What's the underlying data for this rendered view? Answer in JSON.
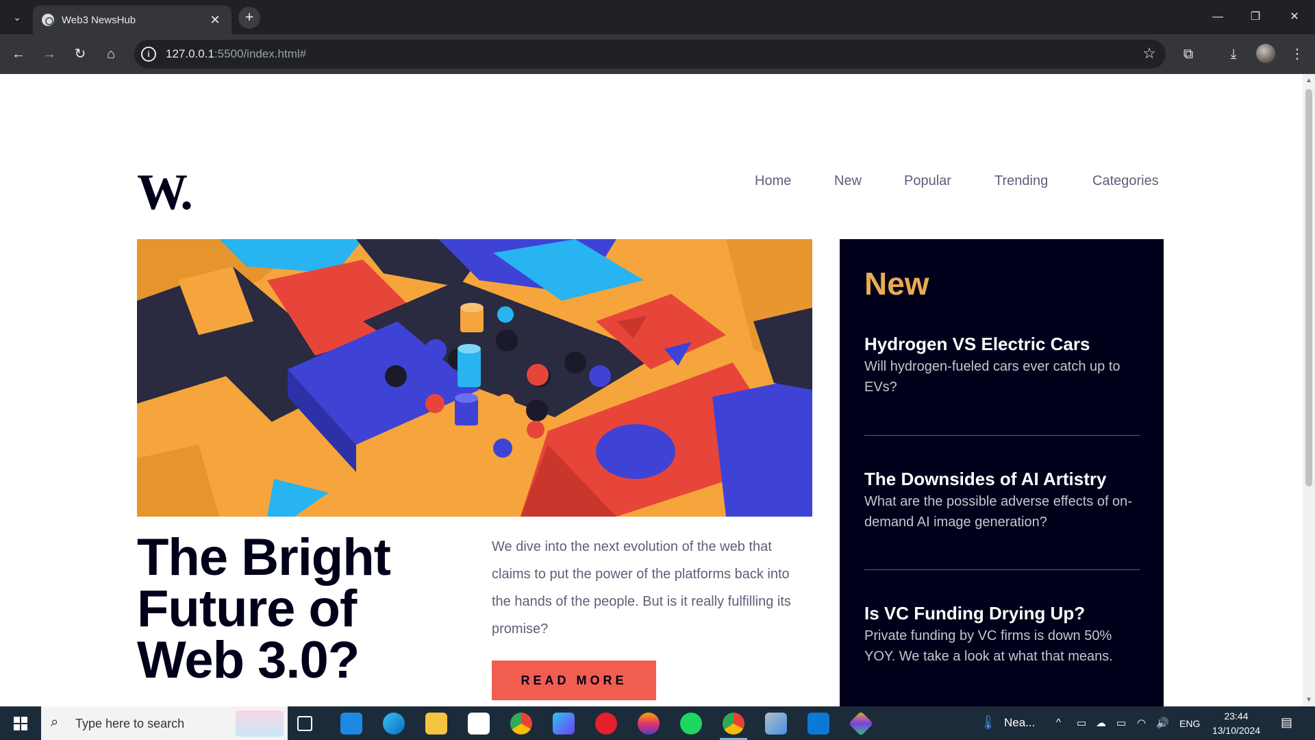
{
  "browser": {
    "tab_title": "Web3 NewsHub",
    "url_host": "127.0.0.1",
    "url_rest": ":5500/index.html#"
  },
  "site": {
    "logo": "W.",
    "nav": [
      "Home",
      "New",
      "Popular",
      "Trending",
      "Categories"
    ],
    "headline_lines": [
      "The Bright",
      "Future of",
      "Web 3.0?"
    ],
    "lede": "We dive into the next evolution of the web that claims to put the power of the platforms back into the hands of the people. But is it really fulfilling its promise?",
    "read_more": "READ MORE",
    "sidebar": {
      "title": "New",
      "items": [
        {
          "title": "Hydrogen VS Electric Cars",
          "desc": "Will hydrogen-fueled cars ever catch up to EVs?"
        },
        {
          "title": "The Downsides of AI Artistry",
          "desc": "What are the possible adverse effects of on-demand AI image generation?"
        },
        {
          "title": "Is VC Funding Drying Up?",
          "desc": "Private funding by VC firms is down 50% YOY. We take a look at what that means."
        }
      ]
    },
    "colors": {
      "dark_navy": "#00001a",
      "accent_orange": "#e9ab53",
      "accent_red": "#f15e50",
      "grayish_blue": "#5d5f79"
    }
  },
  "taskbar": {
    "search_placeholder": "Type here to search",
    "weather": "Nea...",
    "language": "ENG",
    "time": "23:44",
    "date": "13/10/2024"
  }
}
